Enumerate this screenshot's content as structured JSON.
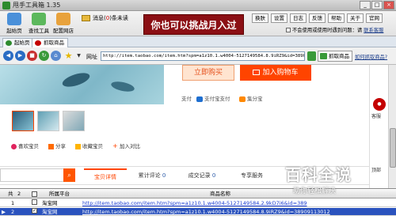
{
  "title_bar": {
    "title": "甩手工具箱",
    "version": "1.35",
    "min": "_",
    "max": "□",
    "close": "×"
  },
  "toolbar": {
    "buttons": [
      {
        "label": "起始页",
        "icon": "home-icon"
      },
      {
        "label": "查找工具",
        "icon": "search-tool-icon"
      },
      {
        "label": "配置网店",
        "icon": "shop-config-icon"
      }
    ],
    "message_prefix": "消息(",
    "message_count": "0",
    "message_suffix": ")条未读",
    "banner_text": "你也可以挑战月入过万!",
    "menu": [
      "换肤",
      "设置",
      "日志",
      "反馈",
      "帮助",
      "关于",
      "官网"
    ],
    "startup_note": "不会使用或使用时遇到问题：请",
    "contact_link": "联系客服"
  },
  "browser_tabs": [
    {
      "label": "起始页",
      "icon": "home-icon",
      "color": "#2e8b2e"
    },
    {
      "label": "抓取商品",
      "icon": "grab-icon",
      "color": "#c40000"
    }
  ],
  "nav": {
    "url_label": "网址",
    "url": "http://item.taobao.com/item.htm?spm=a1z10.1.w4004-5127149584.8.9iRZ9&id=3890911",
    "grab_button": "抓取商品",
    "howto_link": "如何抓取商品?"
  },
  "product": {
    "buy_now": "立即购买",
    "add_cart": "加入购物车",
    "payment_label": "支付",
    "payments": [
      {
        "label": "支付宝支付",
        "color": "#1f6fd0"
      },
      {
        "label": "集分宝",
        "color": "#ff8800"
      }
    ],
    "actions": [
      "喜欢宝贝",
      "分享",
      "收藏宝贝",
      "加入对比"
    ],
    "tabs": [
      "宝贝详情",
      "累计评论",
      "成交记录",
      "专享服务"
    ],
    "review_count": "0",
    "record_count": "0",
    "search_icon": "search-icon"
  },
  "right_side": {
    "service": "客服",
    "top": "顶部"
  },
  "grid": {
    "headers": [
      "共",
      "2",
      "所属平台",
      "商品名称"
    ],
    "rows": [
      {
        "index": "1",
        "checked": false,
        "platform": "淘宝网",
        "url": "http://item.taobao.com/item.htm?spm=a1z10.1.w4004-5127149584.2.9kD7i6&id=389"
      },
      {
        "index": "2",
        "checked": true,
        "platform": "淘宝网",
        "url": "http://item.taobao.com/item.htm?spm=a1z10.1.w4004-5127149584.8.9iRZ9&id=38909113012"
      }
    ]
  },
  "watermark": {
    "big": "百科全说",
    "small": "助你轻松解决"
  }
}
